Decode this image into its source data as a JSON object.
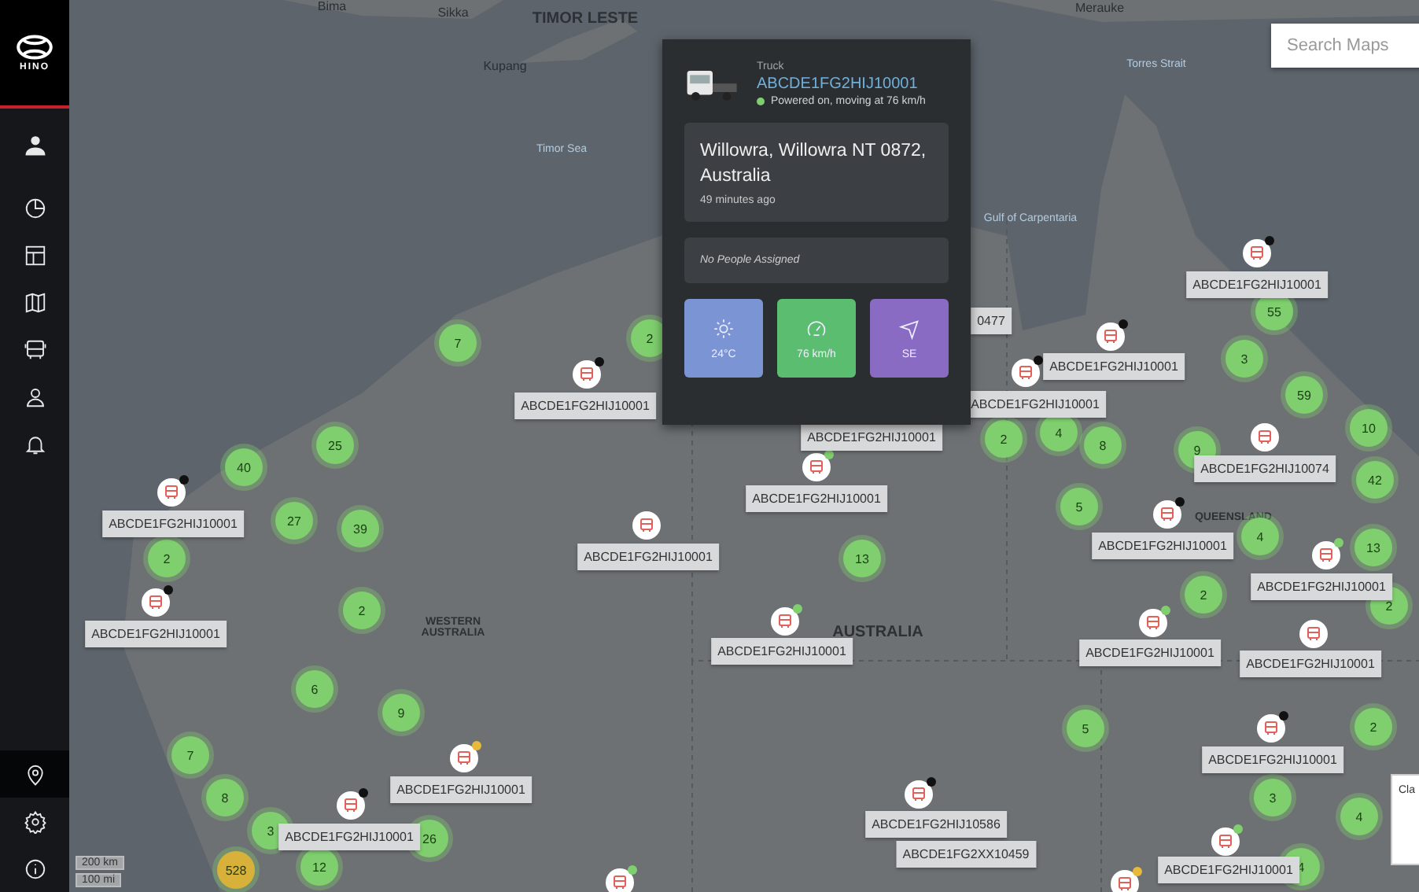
{
  "sidebar": {
    "logo": "HINO",
    "top_items": [
      {
        "kind": "account",
        "selected": false
      }
    ],
    "nav_items": [
      {
        "kind": "dashboard",
        "selected": false
      },
      {
        "kind": "layout",
        "selected": false
      },
      {
        "kind": "map",
        "selected": false
      },
      {
        "kind": "vehicles",
        "selected": false
      },
      {
        "kind": "people",
        "selected": false
      },
      {
        "kind": "alerts",
        "selected": false
      }
    ],
    "bottom_items": [
      {
        "kind": "location",
        "selected": true
      },
      {
        "kind": "settings",
        "selected": false
      },
      {
        "kind": "info",
        "selected": false
      }
    ]
  },
  "map": {
    "place_labels": [
      {
        "text": "Bima",
        "kind": "city"
      },
      {
        "text": "Sikka",
        "kind": "city"
      },
      {
        "text": "TIMOR LESTE",
        "kind": "country"
      },
      {
        "text": "Kupang",
        "kind": "city"
      },
      {
        "text": "Timor Sea",
        "kind": "water"
      },
      {
        "text": "Merauke",
        "kind": "city"
      },
      {
        "text": "Torres Strait",
        "kind": "water"
      },
      {
        "text": "Gulf of Carpentaria",
        "kind": "water"
      },
      {
        "text": "WESTERN AUSTRALIA",
        "kind": "region"
      },
      {
        "text": "AUSTRALIA",
        "kind": "country"
      },
      {
        "text": "QUEENSLAND",
        "kind": "region"
      }
    ],
    "clusters": [
      {
        "count": "7",
        "color": "#7fcf6e"
      },
      {
        "count": "2",
        "color": "#7fcf6e"
      },
      {
        "count": "40",
        "color": "#7fcf6e"
      },
      {
        "count": "25",
        "color": "#7fcf6e"
      },
      {
        "count": "27",
        "color": "#7fcf6e"
      },
      {
        "count": "39",
        "color": "#7fcf6e"
      },
      {
        "count": "2",
        "color": "#7fcf6e"
      },
      {
        "count": "2",
        "color": "#7fcf6e"
      },
      {
        "count": "6",
        "color": "#7fcf6e"
      },
      {
        "count": "9",
        "color": "#7fcf6e"
      },
      {
        "count": "7",
        "color": "#7fcf6e"
      },
      {
        "count": "8",
        "color": "#7fcf6e"
      },
      {
        "count": "3",
        "color": "#7fcf6e"
      },
      {
        "count": "26",
        "color": "#7fcf6e"
      },
      {
        "count": "528",
        "color": "#d8b13a"
      },
      {
        "count": "12",
        "color": "#7fcf6e"
      },
      {
        "count": "13",
        "color": "#7fcf6e"
      },
      {
        "count": "2",
        "color": "#7fcf6e"
      },
      {
        "count": "4",
        "color": "#7fcf6e"
      },
      {
        "count": "8",
        "color": "#7fcf6e"
      },
      {
        "count": "9",
        "color": "#7fcf6e"
      },
      {
        "count": "5",
        "color": "#7fcf6e"
      },
      {
        "count": "4",
        "color": "#7fcf6e"
      },
      {
        "count": "2",
        "color": "#7fcf6e"
      },
      {
        "count": "55",
        "color": "#7fcf6e"
      },
      {
        "count": "3",
        "color": "#7fcf6e"
      },
      {
        "count": "59",
        "color": "#7fcf6e"
      },
      {
        "count": "10",
        "color": "#7fcf6e"
      },
      {
        "count": "42",
        "color": "#7fcf6e"
      },
      {
        "count": "13",
        "color": "#7fcf6e"
      },
      {
        "count": "2",
        "color": "#7fcf6e"
      },
      {
        "count": "5",
        "color": "#7fcf6e"
      },
      {
        "count": "2",
        "color": "#7fcf6e"
      },
      {
        "count": "3",
        "color": "#7fcf6e"
      },
      {
        "count": "4",
        "color": "#7fcf6e"
      },
      {
        "count": "4",
        "color": "#7fcf6e"
      }
    ],
    "vehicles": [
      {
        "kind": "marker",
        "label": "ABCDE1FG2HIJ10001",
        "color": "#111111"
      },
      {
        "kind": "marker",
        "label": "ABCDE1FG2HIJ10001",
        "color": "#111111"
      },
      {
        "kind": "marker",
        "label": "ABCDE1FG2HIJ10001",
        "color": "#111111"
      },
      {
        "kind": "marker",
        "label": "ABCDE1FG2HIJ10001",
        "color": "#111111"
      },
      {
        "kind": "marker",
        "label": "ABCDE1FG2HIJ10001",
        "color": "#111111"
      },
      {
        "kind": "marker",
        "label": "ABCDE1FG2HIJ10001",
        "color": "#111111"
      },
      {
        "kind": "marker",
        "label": "ABCDE1FG2HIJ10001",
        "color": "#7fcf6e"
      },
      {
        "kind": "marker",
        "label": "ABCDE1FG2HIJ10001"
      },
      {
        "kind": "marker",
        "label": "ABCDE1FG2HIJ10001",
        "color": "#111111"
      },
      {
        "kind": "marker",
        "label": "ABCDE1FG2HIJ10001",
        "color": "#7fcf6e"
      },
      {
        "kind": "marker",
        "label": "ABCDE1FG2HIJ10001",
        "color": "#7fcf6e"
      },
      {
        "kind": "marker",
        "label": "ABCDE1FG2HIJ10001",
        "color": "#7fcf6e"
      },
      {
        "kind": "marker",
        "label": "ABCDE1FG2HIJ10001"
      },
      {
        "kind": "marker",
        "label": "ABCDE1FG2HIJ10001",
        "color": "#e8b93a"
      },
      {
        "kind": "marker",
        "label": "ABCDE1FG2HIJ10001",
        "color": "#111111"
      },
      {
        "kind": "marker",
        "label": "ABCDE1FG2HIJ10001",
        "color": "#111111"
      },
      {
        "kind": "marker",
        "label": "ABCDE1FG2HIJ10586",
        "color": "#111111"
      },
      {
        "kind": "marker",
        "label": "ABCDE1FG2HIJ10074"
      },
      {
        "kind": "marker",
        "label": "ABCDE1FG2HIJ10001",
        "color": "#7fcf6e"
      },
      {
        "kind": "marker",
        "color": "#7fcf6e"
      },
      {
        "kind": "marker",
        "color": "#e8b93a"
      },
      {
        "kind": "label",
        "label": "ABCDE1FG2XX10459"
      },
      {
        "kind": "label",
        "label": "ABCDE1FG2HIJ10001"
      },
      {
        "kind": "label",
        "label": "0477"
      }
    ],
    "scale": [
      "200 km",
      "100 mi"
    ],
    "search": {
      "placeholder": "Search Maps"
    },
    "side_card": {
      "text": "Cla"
    }
  },
  "popup": {
    "type": "Truck",
    "vehicle_id": "ABCDE1FG2HIJ10001",
    "status": {
      "text": "Powered on, moving at 76 km/h",
      "color": "#7fcf6e"
    },
    "address": "Willowra, Willowra NT 0872, Australia",
    "time_ago": "49 minutes ago",
    "people": "No People Assigned",
    "tiles": [
      {
        "kind": "temperature",
        "value": "24°C",
        "color": "#7b94d4"
      },
      {
        "kind": "speed",
        "value": "76 km/h",
        "color": "#5bbd6f"
      },
      {
        "kind": "heading",
        "value": "SE",
        "color": "#8a6bc4"
      }
    ]
  }
}
